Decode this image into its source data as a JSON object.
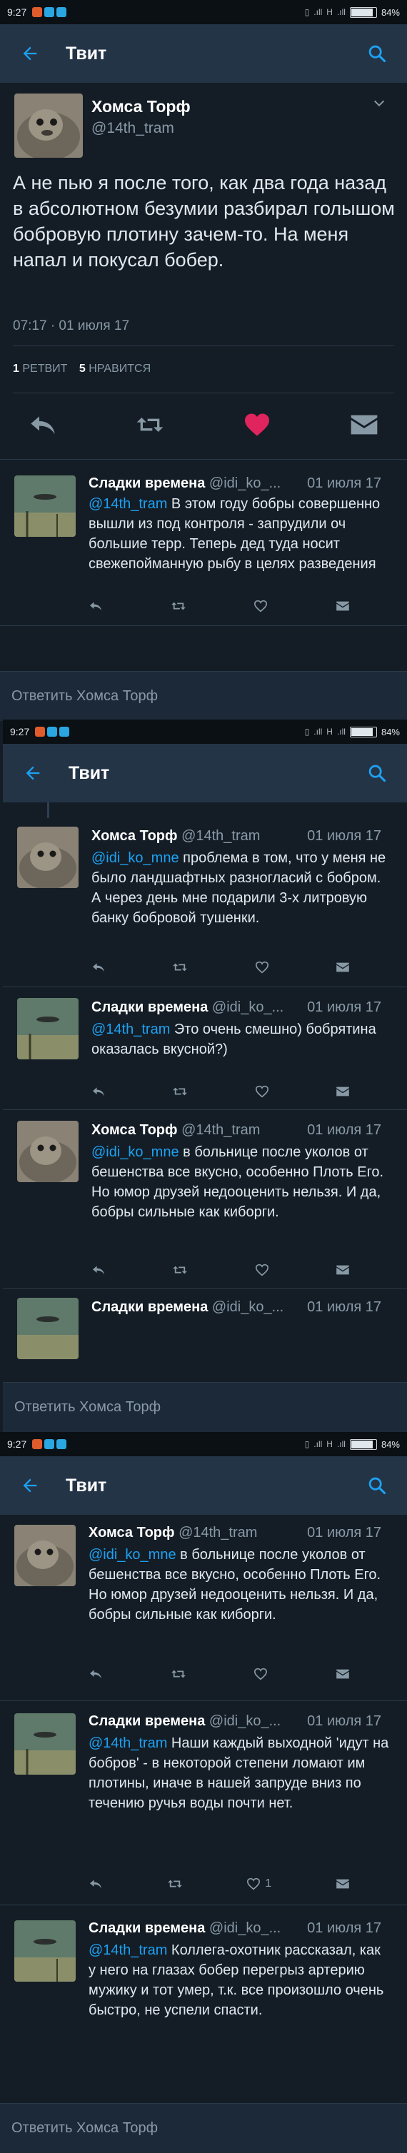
{
  "statusbar": {
    "time": "9:27",
    "signal_text": "H",
    "battery_text": "84%",
    "battery_level": 0.84
  },
  "appbar": {
    "title": "Твит",
    "back_icon": "arrow-left-icon",
    "search_icon": "search-icon"
  },
  "colors": {
    "background": "#141d26",
    "appbar": "#243447",
    "accent": "#1da1f2",
    "like": "#e0245e"
  },
  "screen1": {
    "main_tweet": {
      "name": "Хомса Торф",
      "handle": "@14th_tram",
      "text": "А не пью я после того, как два года назад в абсолютном безумии разбирал голышом бобровую плотину зачем-то. На меня напал и покусал бобер.",
      "timestamp": "07:17 · 01 июля 17",
      "retweets_count": "1",
      "retweets_label": "РЕТВИТ",
      "likes_count": "5",
      "likes_label": "НРАВИТСЯ"
    },
    "reply1": {
      "name": "Сладки времена",
      "handle": "@idi_ko_...",
      "date": "01 июля 17",
      "mention": "@14th_tram",
      "text": " В этом году бобры совершенно вышли из под контроля - запрудили оч большие терр. Теперь дед туда носит свежепойманную рыбу в целях разведения"
    },
    "composer_placeholder": "Ответить Хомса Торф"
  },
  "screen2": {
    "replies": [
      {
        "name": "Хомса Торф",
        "handle": "@14th_tram",
        "date": "01 июля 17",
        "mention": "@idi_ko_mne",
        "text": " проблема в том, что у меня не было ландшафтных разногласий с бобром. А через день мне подарили 3-х литровую банку бобровой тушенки."
      },
      {
        "name": "Сладки времена",
        "handle": "@idi_ko_...",
        "date": "01 июля 17",
        "mention": "@14th_tram",
        "text": " Это очень смешно) бобрятина оказалась вкусной?)"
      },
      {
        "name": "Хомса Торф",
        "handle": "@14th_tram",
        "date": "01 июля 17",
        "mention": "@idi_ko_mne",
        "text": " в больнице после уколов от бешенства все вкусно, особенно Плоть Его. Но юмор друзей недооценить нельзя. И да, бобры сильные как киборги."
      },
      {
        "name": "Сладки времена",
        "handle": "@idi_ko_...",
        "date": "01 июля 17",
        "mention": "",
        "text": ""
      }
    ],
    "composer_placeholder": "Ответить Хомса Торф"
  },
  "screen3": {
    "replies": [
      {
        "name": "Хомса Торф",
        "handle": "@14th_tram",
        "date": "01 июля 17",
        "mention": "@idi_ko_mne",
        "text": " в больнице после уколов от бешенства все вкусно, особенно Плоть Его. Но юмор друзей недооценить нельзя. И да, бобры сильные как киборги."
      },
      {
        "name": "Сладки времена",
        "handle": "@idi_ko_...",
        "date": "01 июля 17",
        "mention": "@14th_tram",
        "text": " Наши каждый выходной 'идут на бобров' - в некоторой степени ломают им плотины, иначе в нашей запруде вниз по течению ручья воды почти нет.",
        "likes": "1"
      },
      {
        "name": "Сладки времена",
        "handle": "@idi_ko_...",
        "date": "01 июля 17",
        "mention": "@14th_tram",
        "text": " Коллега-охотник рассказал, как у него на глазах бобер перегрыз артерию мужику и тот умер, т.к. все произошло очень быстро, не успели спасти."
      }
    ],
    "composer_placeholder": "Ответить Хомса Торф"
  },
  "reply_actions": {
    "like_count_1": "1"
  }
}
